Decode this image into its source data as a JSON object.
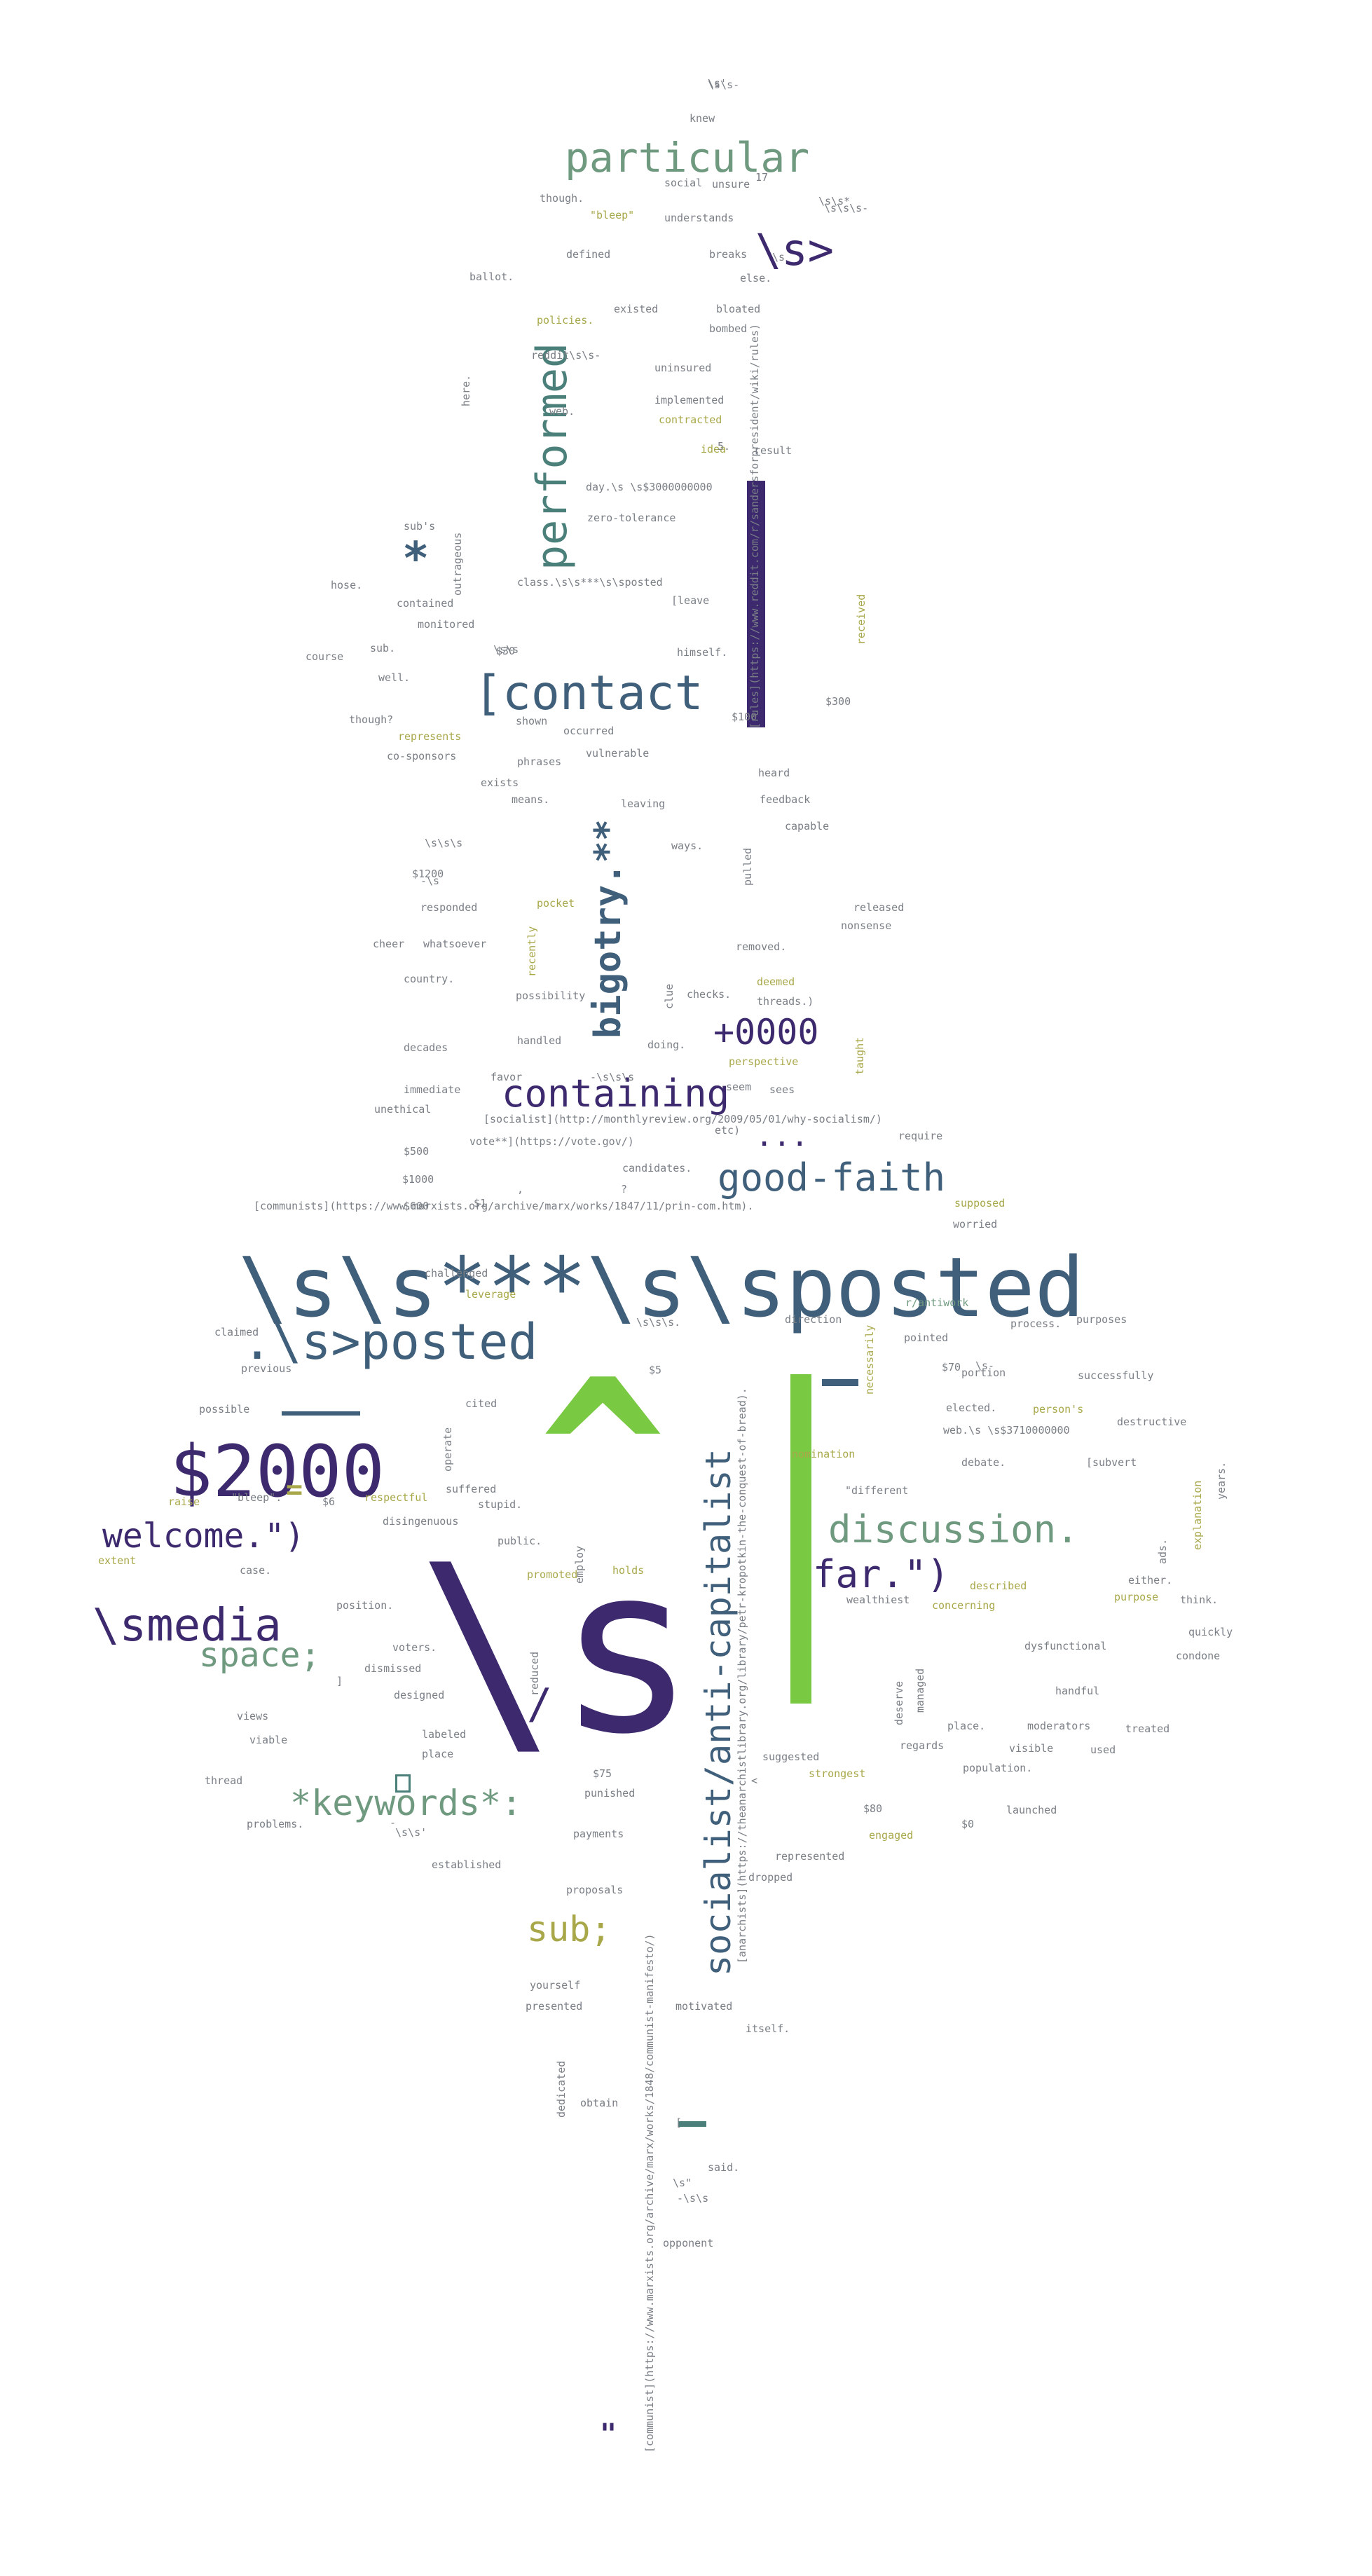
{
  "colors": {
    "background": "#ffffff",
    "navy": "#3d2a6e",
    "slate": "#3f5f7a",
    "teal": "#4b7f7a",
    "green": "#7ac943",
    "sage": "#6f9a80",
    "olive": "#a8a84a",
    "gray": "#7a7f86"
  },
  "words": [
    {
      "text": "\\s\\s***\\s\\sposted",
      "color": "slate"
    },
    {
      "text": "\\s",
      "color": "navy"
    },
    {
      "text": "$2000",
      "color": "navy"
    },
    {
      "text": "^",
      "color": "green"
    },
    {
      "text": "[contact",
      "color": "slate"
    },
    {
      "text": "particular",
      "color": "sage"
    },
    {
      "text": "performed",
      "color": "teal"
    },
    {
      "text": "bigotry.**",
      "color": "slate"
    },
    {
      "text": "containing",
      "color": "navy"
    },
    {
      "text": "good-faith",
      "color": "slate"
    },
    {
      "text": ".\\s>posted",
      "color": "slate"
    },
    {
      "text": "socialist/anti-capitalist",
      "color": "slate"
    },
    {
      "text": "discussion.",
      "color": "sage"
    },
    {
      "text": "far.\")",
      "color": "navy"
    },
    {
      "text": "welcome.\")",
      "color": "navy"
    },
    {
      "text": "\\smedia",
      "color": "navy"
    },
    {
      "text": "space;",
      "color": "sage"
    },
    {
      "text": "*keywords*:",
      "color": "sage"
    },
    {
      "text": "sub;",
      "color": "olive"
    },
    {
      "text": "\\s>",
      "color": "navy"
    },
    {
      "text": "+0000",
      "color": "navy"
    },
    {
      "text": "...",
      "color": "navy"
    },
    {
      "text": "*",
      "color": "slate"
    },
    {
      "text": "/",
      "color": "navy"
    },
    {
      "text": "=",
      "color": "olive"
    },
    {
      "text": "\"",
      "color": "navy"
    },
    {
      "text": "hose.",
      "color": "gray"
    },
    {
      "text": "course",
      "color": "gray"
    },
    {
      "text": "though?",
      "color": "gray"
    },
    {
      "text": "ballot.",
      "color": "gray"
    },
    {
      "text": "defined",
      "color": "gray"
    },
    {
      "text": "though.",
      "color": "gray"
    },
    {
      "text": "breaks",
      "color": "gray"
    },
    {
      "text": "understands",
      "color": "gray"
    },
    {
      "text": "social",
      "color": "gray"
    },
    {
      "text": "\"bleep\"",
      "color": "olive"
    },
    {
      "text": "policies.",
      "color": "olive"
    },
    {
      "text": "existed",
      "color": "gray"
    },
    {
      "text": "bloated",
      "color": "gray"
    },
    {
      "text": "bombed",
      "color": "gray"
    },
    {
      "text": "uninsured",
      "color": "gray"
    },
    {
      "text": "implemented",
      "color": "gray"
    },
    {
      "text": "contracted",
      "color": "olive"
    },
    {
      "text": "idea",
      "color": "olive"
    },
    {
      "text": "result",
      "color": "gray"
    },
    {
      "text": "zero-tolerance",
      "color": "gray"
    },
    {
      "text": "contained",
      "color": "gray"
    },
    {
      "text": "monitored",
      "color": "gray"
    },
    {
      "text": "[leave",
      "color": "gray"
    },
    {
      "text": "himself.",
      "color": "gray"
    },
    {
      "text": "occurred",
      "color": "gray"
    },
    {
      "text": "represents",
      "color": "olive"
    },
    {
      "text": "co-sponsors",
      "color": "gray"
    },
    {
      "text": "phrases",
      "color": "gray"
    },
    {
      "text": "vulnerable",
      "color": "gray"
    },
    {
      "text": "exists",
      "color": "gray"
    },
    {
      "text": "means.",
      "color": "gray"
    },
    {
      "text": "leaving",
      "color": "gray"
    },
    {
      "text": "heard",
      "color": "gray"
    },
    {
      "text": "feedback",
      "color": "gray"
    },
    {
      "text": "capable",
      "color": "gray"
    },
    {
      "text": "ways.",
      "color": "gray"
    },
    {
      "text": "responded",
      "color": "gray"
    },
    {
      "text": "pocket",
      "color": "olive"
    },
    {
      "text": "released",
      "color": "gray"
    },
    {
      "text": "nonsense",
      "color": "gray"
    },
    {
      "text": "whatsoever",
      "color": "gray"
    },
    {
      "text": "removed.",
      "color": "gray"
    },
    {
      "text": "country.",
      "color": "gray"
    },
    {
      "text": "possibility",
      "color": "gray"
    },
    {
      "text": "checks.",
      "color": "gray"
    },
    {
      "text": "deemed",
      "color": "olive"
    },
    {
      "text": "decades",
      "color": "gray"
    },
    {
      "text": "handled",
      "color": "gray"
    },
    {
      "text": "doing.",
      "color": "gray"
    },
    {
      "text": "perspective",
      "color": "olive"
    },
    {
      "text": "immediate",
      "color": "gray"
    },
    {
      "text": "unethical",
      "color": "gray"
    },
    {
      "text": "candidates.",
      "color": "gray"
    },
    {
      "text": "require",
      "color": "gray"
    },
    {
      "text": "challenged",
      "color": "gray"
    },
    {
      "text": "leverage",
      "color": "olive"
    },
    {
      "text": "claimed",
      "color": "gray"
    },
    {
      "text": "previous",
      "color": "gray"
    },
    {
      "text": "supposed",
      "color": "olive"
    },
    {
      "text": "worried",
      "color": "gray"
    },
    {
      "text": "r/antiwork",
      "color": "sage"
    },
    {
      "text": "direction",
      "color": "gray"
    },
    {
      "text": "pointed",
      "color": "gray"
    },
    {
      "text": "process.",
      "color": "gray"
    },
    {
      "text": "purposes",
      "color": "gray"
    },
    {
      "text": "portion",
      "color": "gray"
    },
    {
      "text": "successfully",
      "color": "gray"
    },
    {
      "text": "possible",
      "color": "gray"
    },
    {
      "text": "cited",
      "color": "gray"
    },
    {
      "text": "elected.",
      "color": "gray"
    },
    {
      "text": "person's",
      "color": "olive"
    },
    {
      "text": "destructive",
      "color": "gray"
    },
    {
      "text": "nomination",
      "color": "olive"
    },
    {
      "text": "debate.",
      "color": "gray"
    },
    {
      "text": "suffered",
      "color": "gray"
    },
    {
      "text": "stupid.",
      "color": "gray"
    },
    {
      "text": "respectful",
      "color": "olive"
    },
    {
      "text": "disingenuous",
      "color": "gray"
    },
    {
      "text": "public.",
      "color": "gray"
    },
    {
      "text": "promoted",
      "color": "olive"
    },
    {
      "text": "holds",
      "color": "olive"
    },
    {
      "text": "\"different",
      "color": "gray"
    },
    {
      "text": "described",
      "color": "olive"
    },
    {
      "text": "wealthiest",
      "color": "gray"
    },
    {
      "text": "concerning",
      "color": "olive"
    },
    {
      "text": "purpose",
      "color": "olive"
    },
    {
      "text": "either.",
      "color": "gray"
    },
    {
      "text": "think.",
      "color": "gray"
    },
    {
      "text": "quickly",
      "color": "gray"
    },
    {
      "text": "dysfunctional",
      "color": "gray"
    },
    {
      "text": "condone",
      "color": "gray"
    },
    {
      "text": "handful",
      "color": "gray"
    },
    {
      "text": "moderators",
      "color": "gray"
    },
    {
      "text": "treated",
      "color": "gray"
    },
    {
      "text": "voters.",
      "color": "gray"
    },
    {
      "text": "dismissed",
      "color": "gray"
    },
    {
      "text": "designed",
      "color": "gray"
    },
    {
      "text": "labeled",
      "color": "gray"
    },
    {
      "text": "position.",
      "color": "gray"
    },
    {
      "text": "views",
      "color": "gray"
    },
    {
      "text": "viable",
      "color": "gray"
    },
    {
      "text": "thread",
      "color": "gray"
    },
    {
      "text": "problems.",
      "color": "gray"
    },
    {
      "text": "established",
      "color": "gray"
    },
    {
      "text": "punished",
      "color": "gray"
    },
    {
      "text": "payments",
      "color": "gray"
    },
    {
      "text": "suggested",
      "color": "gray"
    },
    {
      "text": "strongest",
      "color": "olive"
    },
    {
      "text": "regards",
      "color": "gray"
    },
    {
      "text": "visible",
      "color": "gray"
    },
    {
      "text": "population.",
      "color": "gray"
    },
    {
      "text": "launched",
      "color": "gray"
    },
    {
      "text": "engaged",
      "color": "olive"
    },
    {
      "text": "represented",
      "color": "gray"
    },
    {
      "text": "dropped",
      "color": "gray"
    },
    {
      "text": "proposals",
      "color": "gray"
    },
    {
      "text": "yourself",
      "color": "gray"
    },
    {
      "text": "presented",
      "color": "gray"
    },
    {
      "text": "motivated",
      "color": "gray"
    },
    {
      "text": "itself.",
      "color": "gray"
    },
    {
      "text": "obtain",
      "color": "gray"
    },
    {
      "text": "said.",
      "color": "gray"
    },
    {
      "text": "opponent",
      "color": "gray"
    },
    {
      "text": "unsure",
      "color": "gray"
    },
    {
      "text": "knew",
      "color": "gray"
    },
    {
      "text": "else.",
      "color": "gray"
    },
    {
      "text": "sub's",
      "color": "gray"
    },
    {
      "text": "well.",
      "color": "gray"
    },
    {
      "text": "sub.",
      "color": "gray"
    },
    {
      "text": "shown",
      "color": "gray"
    },
    {
      "text": "cheer",
      "color": "gray"
    },
    {
      "text": "favor",
      "color": "gray"
    },
    {
      "text": "seem",
      "color": "gray"
    },
    {
      "text": "sees",
      "color": "gray"
    },
    {
      "text": "raise",
      "color": "olive"
    },
    {
      "text": "extent",
      "color": "olive"
    },
    {
      "text": "case.",
      "color": "gray"
    },
    {
      "text": "place",
      "color": "gray"
    },
    {
      "text": "place.",
      "color": "gray"
    },
    {
      "text": "used",
      "color": "gray"
    },
    {
      "text": "outrageous",
      "color": "gray"
    },
    {
      "text": "recently",
      "color": "olive"
    },
    {
      "text": "reduced",
      "color": "gray"
    },
    {
      "text": "employ",
      "color": "gray"
    },
    {
      "text": "operate",
      "color": "gray"
    },
    {
      "text": "received",
      "color": "olive"
    },
    {
      "text": "necessarily",
      "color": "olive"
    },
    {
      "text": "explanation",
      "color": "olive"
    },
    {
      "text": "managed",
      "color": "gray"
    },
    {
      "text": "deserve",
      "color": "gray"
    },
    {
      "text": "dedicated",
      "color": "gray"
    },
    {
      "text": "pulled",
      "color": "gray"
    },
    {
      "text": "clue",
      "color": "gray"
    },
    {
      "text": "taught",
      "color": "gray"
    },
    {
      "text": "years.",
      "color": "gray"
    },
    {
      "text": "ads.",
      "color": "gray"
    },
    {
      "text": "here.",
      "color": "gray"
    },
    {
      "text": "day.\\s \\s$3000000000",
      "color": "gray"
    },
    {
      "text": "class.\\s\\s***\\s\\sposted",
      "color": "gray"
    },
    {
      "text": "reddit\\s\\s-",
      "color": "gray"
    },
    {
      "text": "[socialist](http://monthlyreview.org/2009/05/01/why-socialism/)",
      "color": "gray"
    },
    {
      "text": "vote**](https://vote.gov/)",
      "color": "gray"
    },
    {
      "text": "[communists](https://www.marxists.org/archive/marx/works/1847/11/prin-com.htm).",
      "color": "gray"
    },
    {
      "text": "[rules](https://www.reddit.com/r/sandersforpresident/wiki/rules)",
      "color": "gray"
    },
    {
      "text": "[anarchists](https://theanarchistlibrary.org/library/petr-kropotkin-the-conquest-of-bread).",
      "color": "gray"
    },
    {
      "text": "[communist](https://www.marxists.org/archive/marx/works/1848/communist-manifesto/)",
      "color": "gray"
    },
    {
      "text": "\\s\\s-",
      "color": "gray"
    },
    {
      "text": "\\s\\s*",
      "color": "gray"
    },
    {
      "text": "\\s\\s",
      "color": "gray"
    },
    {
      "text": "\\s\\s\\s",
      "color": "gray"
    },
    {
      "text": "\\s\\s\\s.",
      "color": "gray"
    },
    {
      "text": "\\s\\s'",
      "color": "gray"
    },
    {
      "text": "\\s\"",
      "color": "gray"
    },
    {
      "text": "web.",
      "color": "gray"
    },
    {
      "text": "web.\\s \\s$3710000000",
      "color": "gray"
    },
    {
      "text": "threads.)",
      "color": "gray"
    },
    {
      "text": "[subvert",
      "color": "gray"
    },
    {
      "text": "\\s-",
      "color": "gray"
    },
    {
      "text": "$300",
      "color": "gray"
    },
    {
      "text": "$30",
      "color": "gray"
    },
    {
      "text": "$1200",
      "color": "gray"
    },
    {
      "text": "$100",
      "color": "gray"
    },
    {
      "text": "$500",
      "color": "gray"
    },
    {
      "text": "$1000",
      "color": "gray"
    },
    {
      "text": "$600",
      "color": "gray"
    },
    {
      "text": "$70",
      "color": "gray"
    },
    {
      "text": "$5",
      "color": "gray"
    },
    {
      "text": "$1",
      "color": "gray"
    },
    {
      "text": "$6",
      "color": "gray"
    },
    {
      "text": "$75",
      "color": "gray"
    },
    {
      "text": "$80",
      "color": "gray"
    },
    {
      "text": "$0",
      "color": "gray"
    },
    {
      "text": "5.",
      "color": "gray"
    },
    {
      "text": "17",
      "color": "gray"
    },
    {
      "text": "etc)",
      "color": "gray"
    },
    {
      "text": "\"bleep\".",
      "color": "gray"
    },
    {
      "text": "?",
      "color": "gray"
    },
    {
      "text": "<",
      "color": "gray"
    },
    {
      "text": "[",
      "color": "gray"
    },
    {
      "text": "]",
      "color": "gray"
    },
    {
      "text": ",",
      "color": "gray"
    },
    {
      "text": "\\s",
      "color": "gray"
    },
    {
      "text": "-",
      "color": "gray"
    },
    {
      "text": "\\s\\s\\s-",
      "color": "gray"
    },
    {
      "text": "-\\s\\s\\s",
      "color": "gray"
    },
    {
      "text": "-\\s",
      "color": "gray"
    },
    {
      "text": "\\s'",
      "color": "gray"
    },
    {
      "text": "-\\s\\s",
      "color": "gray"
    },
    {
      "text": "~\\s",
      "color": "gray"
    }
  ]
}
